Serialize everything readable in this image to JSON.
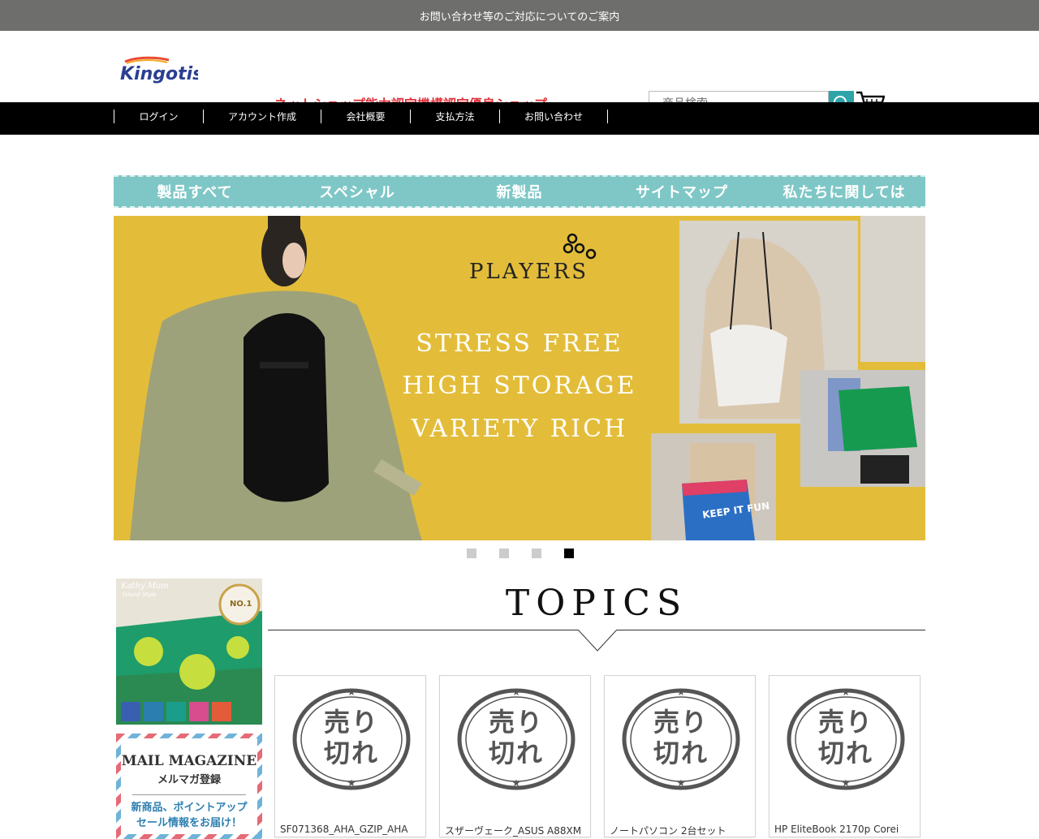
{
  "notice": {
    "text": "お問い合わせ等のご対応についてのご案内"
  },
  "header": {
    "logo_text": "Kingotis",
    "tagline": "ネットショップ能力認定機構認定優良ショップ",
    "search_placeholder": "商品検索",
    "search_icon": "magnifier-icon",
    "cart_icon": "shopping-cart-icon"
  },
  "topnav": {
    "items": [
      "ログイン",
      "アカウント作成",
      "会社概要",
      "支払方法",
      "お問い合わせ"
    ]
  },
  "mainnav": {
    "items": [
      "製品すべて",
      "スペシャル",
      "新製品",
      "サイトマップ",
      "私たちに関しては"
    ]
  },
  "hero": {
    "brand": "PLAYERS",
    "lines": [
      "STRESS FREE",
      "HIGH STORAGE",
      "VARIETY RICH"
    ],
    "bag_text": "KEEP IT FUN",
    "slides_total": 4,
    "active_slide": 4
  },
  "sidebar": {
    "banner1": {
      "brand": "Kathy Mom",
      "brand_sub": "Island Style",
      "badge": "NO.1"
    },
    "mail": {
      "title": "MAIL MAGAZINE",
      "subtitle": "メルマガ登録",
      "line1": "新商品、ポイントアップ",
      "line2": "セール情報をお届け！"
    }
  },
  "topics": {
    "title": "TOPICS",
    "stamp_text": "売り切れ",
    "products": [
      {
        "name": "SF071368_AHA_GZIP_AHA"
      },
      {
        "name": "スザーヴェーク_ASUS A88XM"
      },
      {
        "name": "ノートパソコン 2台セット"
      },
      {
        "name": "HP EliteBook 2170p Corei"
      }
    ]
  },
  "colors": {
    "accent": "#2ea4a9",
    "tagline": "#e0333c",
    "nav_bg": "#000000",
    "menu_bg": "#7fc7c6",
    "hero_bg": "#e3bd3a"
  }
}
